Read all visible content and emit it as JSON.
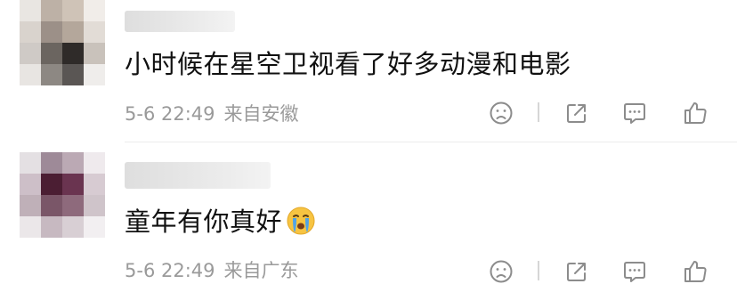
{
  "comments": [
    {
      "username": "",
      "text": "小时候在星空卫视看了好多动漫和电影",
      "date": "5-6 22:49",
      "location": "来自安徽",
      "emoji": ""
    },
    {
      "username": "",
      "text": "童年有你真好",
      "date": "5-6 22:49",
      "location": "来自广东",
      "emoji": "crying-face"
    }
  ],
  "actions": {
    "dislike_icon": "sad-face-icon",
    "share_icon": "share-arrow-icon",
    "reply_icon": "comment-bubble-icon",
    "like_icon": "thumbs-up-icon"
  },
  "colors": {
    "text": "#111111",
    "meta": "#9a9a9a",
    "icon": "#8c8c8c",
    "divider": "#ececec",
    "emoji_face": "#f7c442",
    "emoji_tear": "#4fa3e8"
  }
}
